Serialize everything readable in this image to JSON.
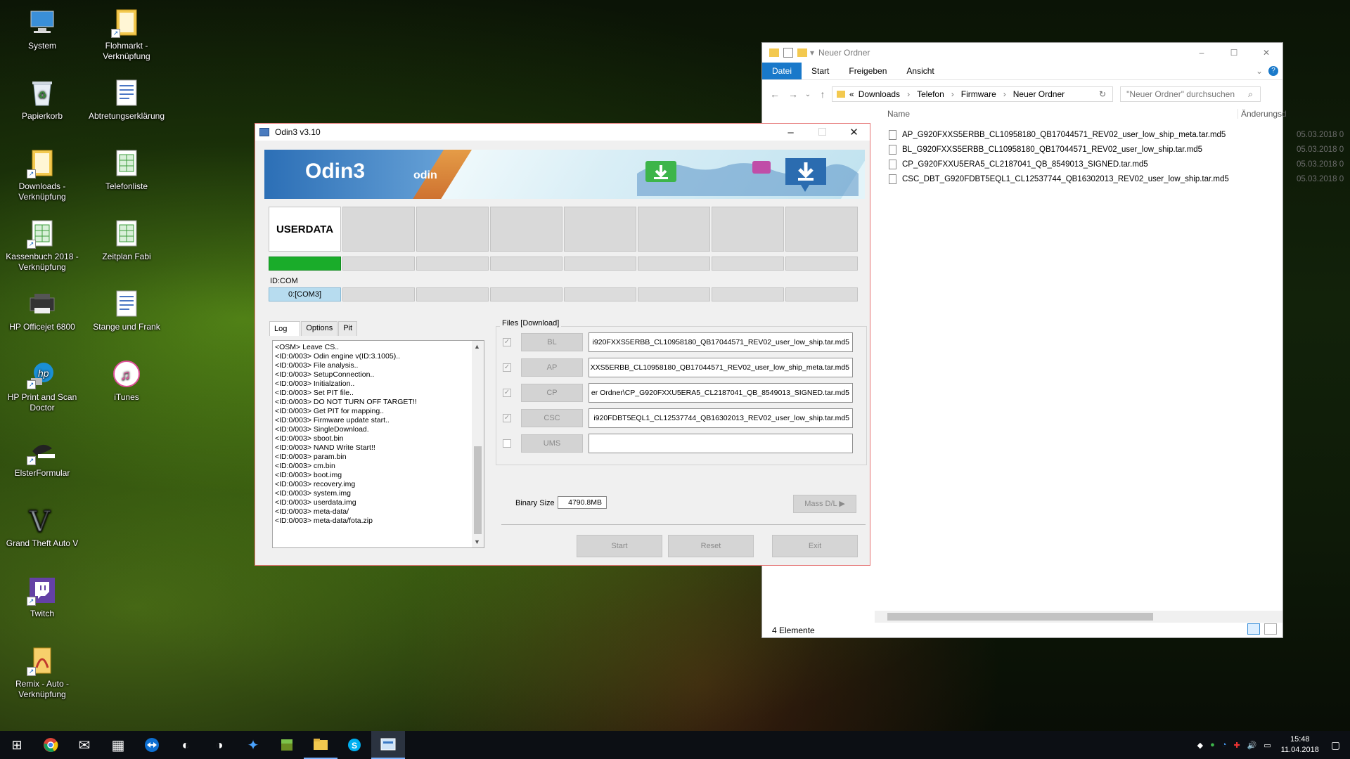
{
  "desktop": {
    "icons": [
      {
        "label": "System",
        "icon": "monitor-icon"
      },
      {
        "label": "Flohmarkt - Verknüpfung",
        "icon": "folder-icon"
      },
      {
        "label": "Papierkorb",
        "icon": "recycle-bin-icon"
      },
      {
        "label": "Abtretungserklärung",
        "icon": "document-icon"
      },
      {
        "label": "Downloads - Verknüpfung",
        "icon": "folder-icon"
      },
      {
        "label": "Telefonliste",
        "icon": "spreadsheet-icon"
      },
      {
        "label": "Kassenbuch 2018 - Verknüpfung",
        "icon": "spreadsheet-icon"
      },
      {
        "label": "Zeitplan Fabi",
        "icon": "spreadsheet-icon"
      },
      {
        "label": "HP Officejet 6800",
        "icon": "printer-icon"
      },
      {
        "label": "Stange und Frank",
        "icon": "document-icon"
      },
      {
        "label": "HP Print and Scan Doctor",
        "icon": "hp-icon"
      },
      {
        "label": "iTunes",
        "icon": "itunes-icon"
      },
      {
        "label": "ElsterFormular",
        "icon": "elster-icon"
      },
      {
        "label": "Grand Theft Auto V",
        "icon": "gta-icon"
      },
      {
        "label": "Twitch",
        "icon": "twitch-icon"
      },
      {
        "label": "Remix - Auto - Verknüpfung",
        "icon": "remix-icon"
      }
    ]
  },
  "odin": {
    "title": "Odin3 v3.10",
    "banner_title": "Odin3",
    "banner_sub": "odin",
    "slot_label": "USERDATA",
    "id_com_label": "ID:COM",
    "com_port": "0:[COM3]",
    "progress": 1.0,
    "tabs": [
      "Log",
      "Options",
      "Pit"
    ],
    "log_lines": [
      "<OSM> Leave CS..",
      "<ID:0/003> Odin engine v(ID:3.1005)..",
      "<ID:0/003> File analysis..",
      "<ID:0/003> SetupConnection..",
      "<ID:0/003> Initialzation..",
      "<ID:0/003> Set PIT file..",
      "<ID:0/003> DO NOT TURN OFF TARGET!!",
      "<ID:0/003> Get PIT for mapping..",
      "<ID:0/003> Firmware update start..",
      "<ID:0/003> SingleDownload.",
      "<ID:0/003> sboot.bin",
      "<ID:0/003> NAND Write Start!!",
      "<ID:0/003> param.bin",
      "<ID:0/003> cm.bin",
      "<ID:0/003> boot.img",
      "<ID:0/003> recovery.img",
      "<ID:0/003> system.img",
      "<ID:0/003> userdata.img",
      "<ID:0/003> meta-data/",
      "<ID:0/003> meta-data/fota.zip"
    ],
    "files_label": "Files [Download]",
    "files": [
      {
        "button": "BL",
        "checked": true,
        "path": "i920FXXS5ERBB_CL10958180_QB17044571_REV02_user_low_ship.tar.md5"
      },
      {
        "button": "AP",
        "checked": true,
        "path": "XXS5ERBB_CL10958180_QB17044571_REV02_user_low_ship_meta.tar.md5"
      },
      {
        "button": "CP",
        "checked": true,
        "path": "er Ordner\\CP_G920FXXU5ERA5_CL2187041_QB_8549013_SIGNED.tar.md5"
      },
      {
        "button": "CSC",
        "checked": true,
        "path": "i920FDBT5EQL1_CL12537744_QB16302013_REV02_user_low_ship.tar.md5"
      },
      {
        "button": "UMS",
        "checked": false,
        "path": ""
      }
    ],
    "binary_size_label": "Binary Size",
    "binary_size": "4790.8MB",
    "mass_dl": "Mass D/L ▶",
    "start": "Start",
    "reset": "Reset",
    "exit": "Exit"
  },
  "explorer": {
    "title": "Neuer Ordner",
    "ribbon_tabs": [
      "Datei",
      "Start",
      "Freigeben",
      "Ansicht"
    ],
    "breadcrumb": [
      "Downloads",
      "Telefon",
      "Firmware",
      "Neuer Ordner"
    ],
    "search_placeholder": "\"Neuer Ordner\" durchsuchen",
    "col_name": "Name",
    "col_date": "Änderungsd",
    "files": [
      {
        "name": "AP_G920FXXS5ERBB_CL10958180_QB17044571_REV02_user_low_ship_meta.tar.md5",
        "date": "05.03.2018 0"
      },
      {
        "name": "BL_G920FXXS5ERBB_CL10958180_QB17044571_REV02_user_low_ship.tar.md5",
        "date": "05.03.2018 0"
      },
      {
        "name": "CP_G920FXXU5ERA5_CL2187041_QB_8549013_SIGNED.tar.md5",
        "date": "05.03.2018 0"
      },
      {
        "name": "CSC_DBT_G920FDBT5EQL1_CL12537744_QB16302013_REV02_user_low_ship.tar.md5",
        "date": "05.03.2018 0"
      }
    ],
    "status": "4 Elemente"
  },
  "taskbar": {
    "time": "15:48",
    "date": "11.04.2018"
  }
}
